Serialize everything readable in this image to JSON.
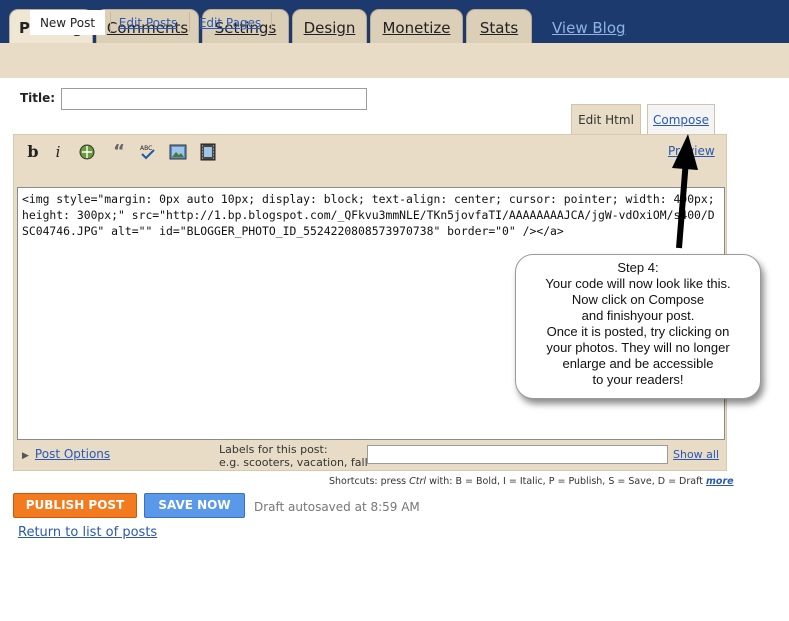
{
  "tabs": [
    {
      "label": "Posting",
      "active": true
    },
    {
      "label": "Comments",
      "active": false
    },
    {
      "label": "Settings",
      "active": false
    },
    {
      "label": "Design",
      "active": false
    },
    {
      "label": "Monetize",
      "active": false
    },
    {
      "label": "Stats",
      "active": false
    }
  ],
  "view_blog": "View Blog",
  "subtabs": [
    {
      "label": "New Post",
      "active": true
    },
    {
      "label": "Edit Posts",
      "active": false
    },
    {
      "label": "Edit Pages",
      "active": false
    }
  ],
  "title_label": "Title:",
  "title_value": "",
  "mode_tabs": {
    "html": "Edit Html",
    "compose": "Compose"
  },
  "toolbar": {
    "bold": "b",
    "italic": "i",
    "icons": [
      "bold-icon",
      "italic-icon",
      "link-icon",
      "blockquote-icon",
      "spellcheck-icon",
      "image-icon",
      "video-icon"
    ]
  },
  "preview_label": "Preview",
  "code": "<img style=\"margin: 0px auto 10px; display: block; text-align: center; cursor: pointer; width: 400px; height: 300px;\" src=\"http://1.bp.blogspot.com/_QFkvu3mmNLE/TKn5jovfaTI/AAAAAAAAJCA/jgW-vdOxiOM/s400/DSC04746.JPG\" alt=\"\" id=\"BLOGGER_PHOTO_ID_5524220808573970738\" border=\"0\" /></a>",
  "post_options": "Post Options",
  "labels": {
    "caption": "Labels for this post:",
    "example": "e.g. scooters, vacation, fall",
    "value": "",
    "show_all": "Show all"
  },
  "shortcuts": {
    "prefix": "Shortcuts: press",
    "key": "Ctrl",
    "with": "with:",
    "list": "B = Bold, I = Italic, P = Publish, S = Save, D = Draft",
    "more": "more"
  },
  "buttons": {
    "publish": "PUBLISH POST",
    "save": "SAVE NOW"
  },
  "autosave_text": "Draft autosaved at 8:59 AM",
  "return_link": "Return to list of posts",
  "callout_lines": [
    "Step 4:",
    "Your code will now look like this.",
    "Now click on Compose",
    "and finishyour post.",
    "Once it is posted, try clicking on",
    "your photos. They will no longer",
    "enlarge and be accessible",
    "to your readers!"
  ],
  "colors": {
    "topbar": "#1d3a6e",
    "tab_bg": "#dccfb8",
    "panel_bg": "#e8dcc6",
    "link": "#2a58b3",
    "publish": "#f47a1f",
    "save": "#5a98ea"
  }
}
